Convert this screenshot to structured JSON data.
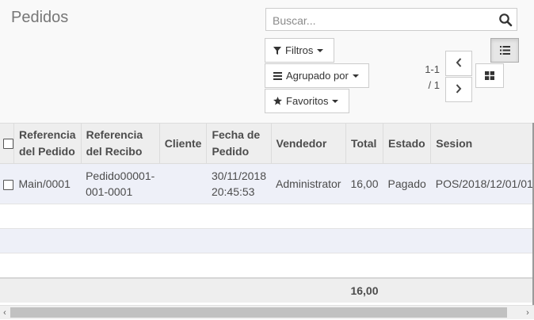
{
  "title": "Pedidos",
  "search": {
    "placeholder": "Buscar..."
  },
  "buttons": {
    "filters": "Filtros",
    "group_by": "Agrupado por",
    "favorites": "Favoritos"
  },
  "pager": {
    "range": "1-1",
    "total": "/ 1"
  },
  "icons": {
    "search": "search-icon",
    "filter": "filter-icon",
    "group": "bars-icon",
    "star": "star-icon",
    "prev": "chevron-left-icon",
    "next": "chevron-right-icon",
    "list_view": "list-view-icon",
    "kanban_view": "kanban-view-icon"
  },
  "table": {
    "headers": {
      "ref_order": "Referencia del Pedido",
      "ref_receipt": "Referencia del Recibo",
      "client": "Cliente",
      "date": "Fecha de Pedido",
      "seller": "Vendedor",
      "total": "Total",
      "state": "Estado",
      "session": "Sesion"
    },
    "rows": [
      {
        "ref_order": "Main/0001",
        "ref_receipt": "Pedido00001-001-0001",
        "client": "",
        "date": "30/11/2018 20:45:53",
        "seller": "Administrator",
        "total": "16,00",
        "state": "Pagado",
        "session": "POS/2018/12/01/01"
      }
    ],
    "footer_total": "16,00"
  },
  "colors": {
    "header_bg": "#eeeeee",
    "row_stripe": "#eef0f8",
    "panel_bg": "#f9f9f9"
  }
}
